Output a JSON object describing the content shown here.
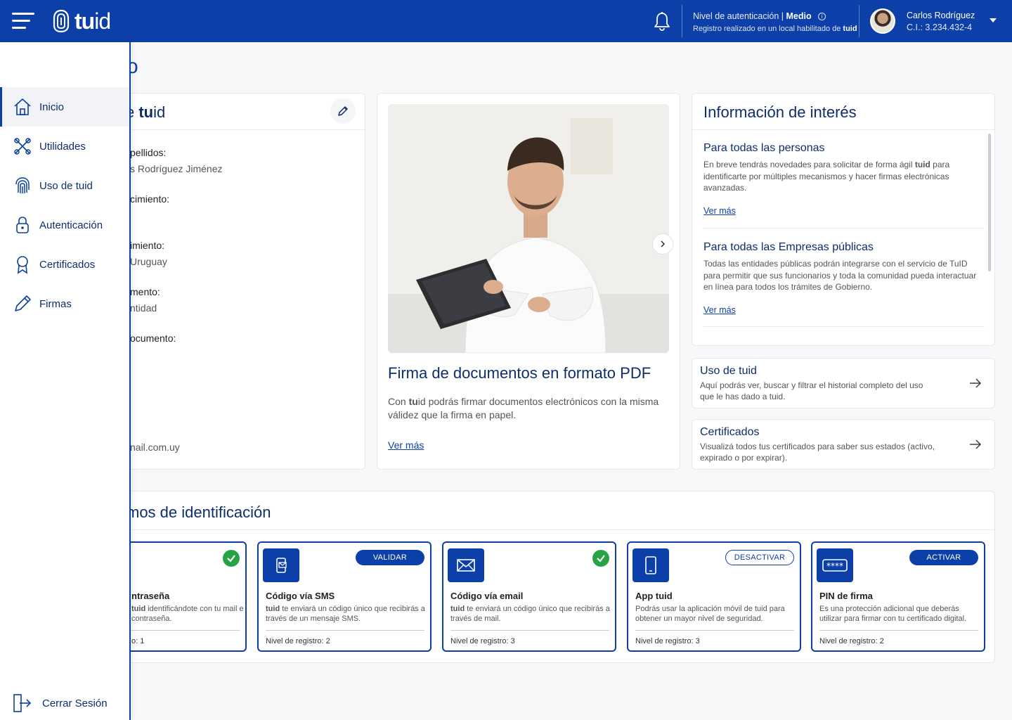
{
  "header": {
    "logo_text_bold": "tu",
    "logo_text_light": "id",
    "auth_level_label": "Nivel de autenticación | ",
    "auth_level_value": "Medio",
    "auth_registration": "Registro realizado en un local habilitado de ",
    "auth_registration_brand": "tuid",
    "user_name": "Carlos Rodríguez",
    "user_ci": "C.I.: 3.234.432-4"
  },
  "page": {
    "title_fragment": "o"
  },
  "profile_card": {
    "title_fragment_light": "e ",
    "title_fragment_bold": "tu",
    "title_fragment_light2": "id",
    "fields": [
      {
        "label": "pellidos:",
        "value": "s Rodríguez Jiménez"
      },
      {
        "label": "cimiento:",
        "value": ""
      },
      {
        "label": "imiento:",
        "value": "Uruguay"
      },
      {
        "label": "mento:",
        "value": "ntidad"
      },
      {
        "label": "ocumento:",
        "value": ""
      }
    ],
    "email_fragment": "nail.com.uy"
  },
  "promo": {
    "title": "Firma de documentos en formato PDF",
    "text_prefix": "Con ",
    "text_brand_bold": "tu",
    "text_brand_light": "id",
    "text_suffix": " podrás firmar documentos electrónicos con la misma válidez que la firma en papel.",
    "link": "Ver más"
  },
  "info": {
    "title": "Información de interés",
    "items": [
      {
        "heading": "Para todas las personas",
        "text_prefix": "En breve tendrás novedades para solicitar de forma ágil ",
        "text_bold": "tuid",
        "text_suffix": " para identificarte por múltiples mecanismos y hacer firmas electrónicas avanzadas.",
        "link": "Ver más"
      },
      {
        "heading": "Para todas las Empresas públicas",
        "text_prefix": "Todas las entidades públicas podrán integrarse con el servicio de TuID para permitir que sus funcionarios y toda la comunidad pueda interactuar en línea para todos los trámites de Gobierno.",
        "text_bold": "",
        "text_suffix": "",
        "link": "Ver más"
      }
    ]
  },
  "shortcuts": [
    {
      "title": "Uso de tuid",
      "text": "Aquí podrás ver, buscar y filtrar el historial completo del uso que le has dado a tuid."
    },
    {
      "title": "Certificados",
      "text": "Visualizá todos tus certificados para saber sus estados (activo, expirado o por expirar)."
    }
  ],
  "methods_section": {
    "title_fragment": "mos de identificación"
  },
  "methods": [
    {
      "name": "ntraseña",
      "desc_bold": "tuid",
      "desc": " identificándote con tu mail e contraseña.",
      "level": "o: 1",
      "action": "",
      "status": "verified"
    },
    {
      "name": "Código vía SMS",
      "desc_bold": "tuid",
      "desc": " te enviará un código único que recibirás a través de un mensaje SMS.",
      "level": "Nivel de registro: 2",
      "action": "VALIDAR",
      "status": "solid"
    },
    {
      "name": "Código vía email",
      "desc_bold": "tuid",
      "desc": " te enviará un código único que recibirás a través de mail.",
      "level": "Nivel de registro: 3",
      "action": "",
      "status": "verified"
    },
    {
      "name": "App tuid",
      "desc_bold": "",
      "desc": "Podrás usar la aplicación móvil de tuid para obtener un mayor nivel de seguridad.",
      "level": "Nivel de registro: 3",
      "action": "DESACTIVAR",
      "status": "outline"
    },
    {
      "name": "PIN de firma",
      "desc_bold": "",
      "desc": "Es una protección adicional que deberás utilizar para firmar con tu certificado digital.",
      "level": "Nivel de registro: 2",
      "action": "ACTIVAR",
      "status": "solid"
    }
  ],
  "sidebar": {
    "items": [
      {
        "label": "Inicio",
        "icon": "home-icon"
      },
      {
        "label": "Utilidades",
        "icon": "tools-icon"
      },
      {
        "label": "Uso de tuid",
        "icon": "fingerprint-icon"
      },
      {
        "label": "Autenticación",
        "icon": "lock-icon"
      },
      {
        "label": "Certificados",
        "icon": "badge-icon"
      },
      {
        "label": "Firmas",
        "icon": "pen-icon"
      }
    ],
    "logout_label": "Cerrar Sesión"
  },
  "colors": {
    "brand": "#0c3fa8",
    "success": "#27a244"
  }
}
